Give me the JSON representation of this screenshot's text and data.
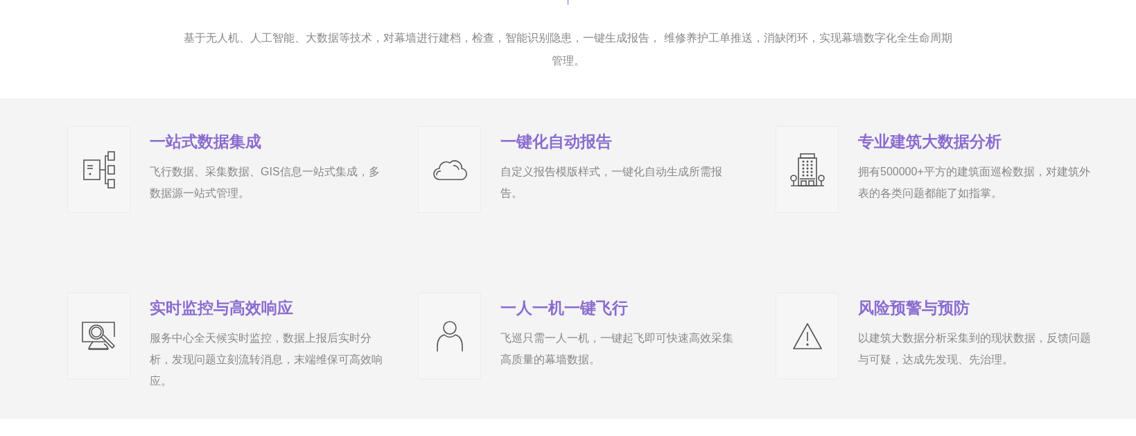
{
  "intro": "基于无人机、人工智能、大数据等技术，对幕墙进行建档，检查，智能识别隐患，一键生成报告， 维修养护工单推送，消缺闭环，实现幕墙数字化全生命周期管理。",
  "features": [
    {
      "kind": "hierarchy",
      "title": "一站式数据集成",
      "description": "飞行数据、采集数据、GIS信息一站式集成，多数据源一站式管理。"
    },
    {
      "kind": "cloud",
      "title": "一键化自动报告",
      "description": "自定义报告模版样式，一键化自动生成所需报告。"
    },
    {
      "kind": "building",
      "title": "专业建筑大数据分析",
      "description": "拥有500000+平方的建筑面巡检数据，对建筑外表的各类问题都能了如指掌。"
    },
    {
      "kind": "monitor",
      "title": "实时监控与高效响应",
      "description": "服务中心全天候实时监控，数据上报后实时分析，发现问题立刻流转消息，末端维保可高效响应。"
    },
    {
      "kind": "person",
      "title": "一人一机一键飞行",
      "description": "飞巡只需一人一机，一键起飞即可快速高效采集高质量的幕墙数据。"
    },
    {
      "kind": "warning",
      "title": "风险预警与预防",
      "description": "以建筑大数据分析采集到的现状数据，反馈问题与可疑，达成先发现、先治理。"
    }
  ]
}
